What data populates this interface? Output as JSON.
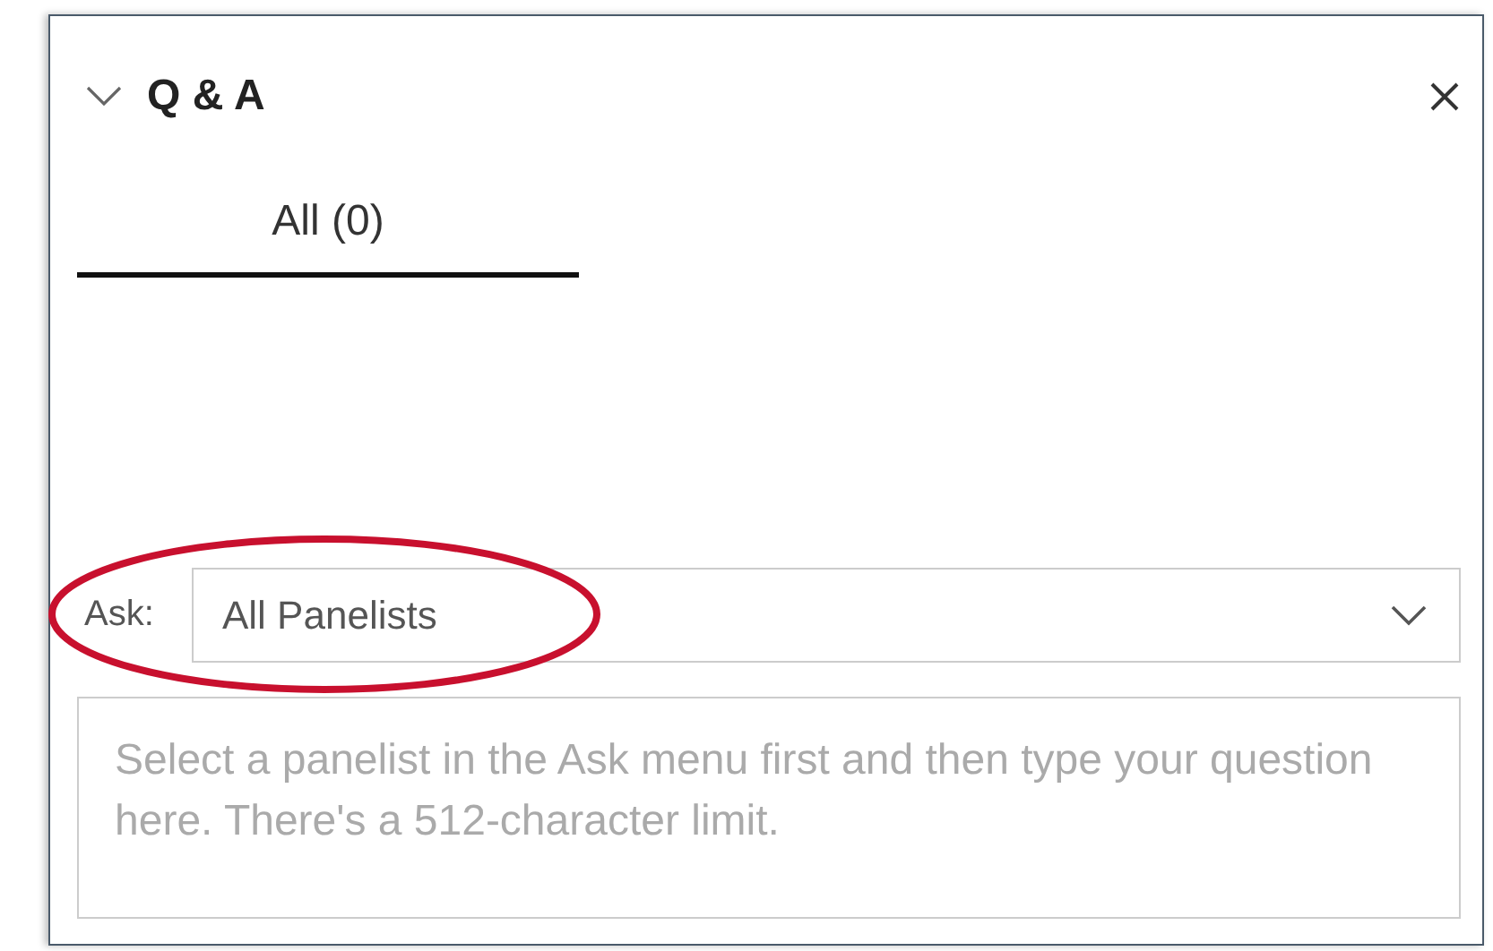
{
  "panel": {
    "title": "Q & A",
    "expanded": true
  },
  "tabs": [
    {
      "label": "All (0)",
      "selected": true
    }
  ],
  "ask": {
    "label": "Ask:",
    "value": "All Panelists"
  },
  "question": {
    "placeholder": "Select a panelist in the Ask menu first and then type your question here. There's a 512-character limit."
  }
}
